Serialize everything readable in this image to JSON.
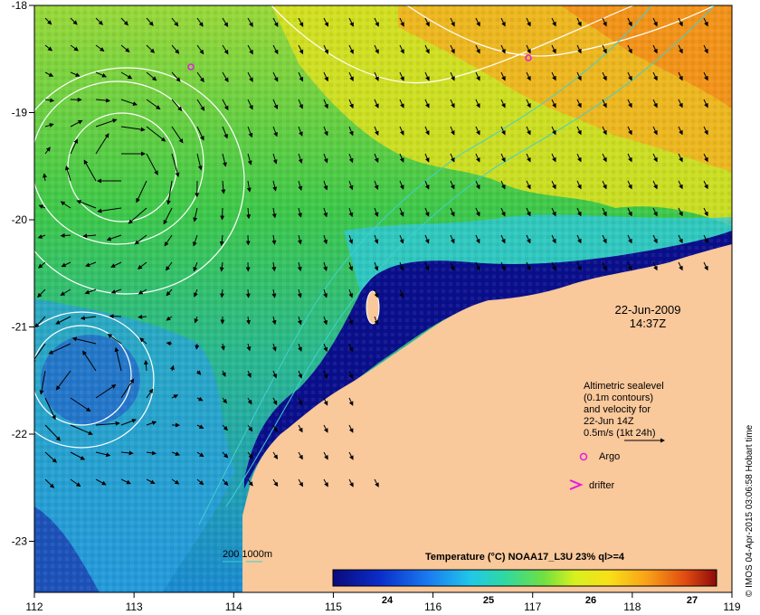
{
  "map": {
    "lon_ticks": [
      "112",
      "113",
      "114",
      "115",
      "116",
      "117",
      "118",
      "119"
    ],
    "lat_ticks": [
      "-18",
      "-19",
      "-20",
      "-21",
      "-22",
      "-23"
    ],
    "datetime": {
      "date": "22-Jun-2009",
      "time": "14:37Z"
    },
    "depth_legend": {
      "label": "200  1000m"
    },
    "legend": {
      "lines": [
        "Altimetric sealevel",
        "(0.1m contours)",
        "and velocity for",
        "22-Jun 14Z",
        "0.5m/s (1kt 24h)"
      ],
      "argo_label": "Argo",
      "drifter_label": "drifter"
    },
    "colorbar": {
      "title": "Temperature (°C) NOAA17_L3U 23% ql>=4",
      "ticks": [
        "24",
        "25",
        "26",
        "27"
      ]
    },
    "credit": "© IMOS 04-Apr-2015 03:06:58 Hobart time",
    "colors": {
      "land": "#f9c89b",
      "cold": "#0a0f8c",
      "warm": "#f2a31c",
      "argo_marker": "#e21ce0",
      "depth_contour": "#40d0d0"
    }
  }
}
